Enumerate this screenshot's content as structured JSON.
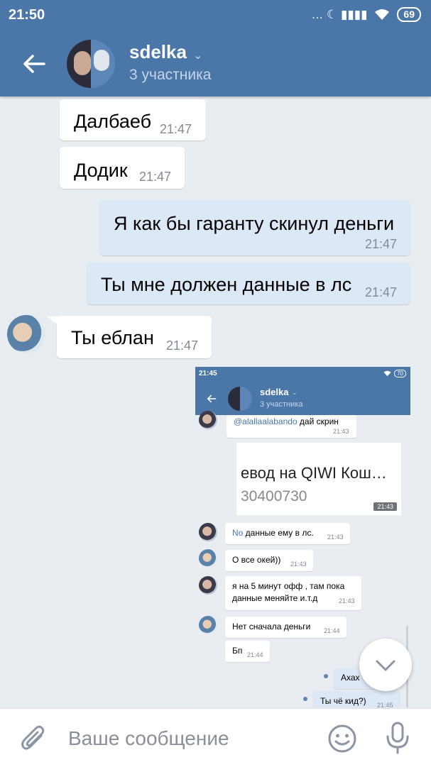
{
  "status_bar": {
    "time": "21:50",
    "icons": "… ☾ ▮▮▮▮",
    "battery": "69"
  },
  "header": {
    "title": "sdelka",
    "chevron": "⌄",
    "subtitle": "3 участника"
  },
  "messages": [
    {
      "text": "Далбаеб",
      "time": "21:47",
      "direction": "in"
    },
    {
      "text": "Додик",
      "time": "21:47",
      "direction": "in"
    },
    {
      "text": "Я как бы гаранту скинул деньги",
      "time": "21:47",
      "direction": "out"
    },
    {
      "text": "Ты мне должен данные в лс",
      "time": "21:47",
      "direction": "out"
    },
    {
      "text": "Ты еблан",
      "time": "21:47",
      "direction": "in"
    }
  ],
  "attached_screenshot": {
    "status": {
      "time": "21:45",
      "battery": "70"
    },
    "header": {
      "title": "sdelka",
      "chevron": "⌄",
      "subtitle": "3 участника"
    },
    "messages": [
      {
        "mention": "@alallaalabando",
        "text": " дай скрин",
        "time": "21:43"
      },
      {
        "mention": "No",
        "text": " данные ему в лс.",
        "time": "21:43"
      },
      {
        "text": "О все окей))",
        "time": "21:43"
      },
      {
        "line1": "я на 5 минут офф , там пока",
        "line2": "данные меняйте и.т.д",
        "time": "21:43"
      },
      {
        "text": "Нет сначала деньги",
        "time": "21:44"
      },
      {
        "text": "Бп",
        "time": "21:44"
      },
      {
        "text": "Ахах",
        "time": ""
      },
      {
        "text": "Ты чё кид?)",
        "time": "21:45"
      }
    ],
    "qiwi_image": {
      "line1": "евод на QIWI Кош…",
      "line2": "30400730",
      "time": "21:43"
    }
  },
  "composer": {
    "placeholder": "Ваше сообщение"
  },
  "colors": {
    "header": "#4a76a8",
    "outgoing": "#dce8f6",
    "incoming": "#ffffff",
    "background": "#e8edf2"
  }
}
